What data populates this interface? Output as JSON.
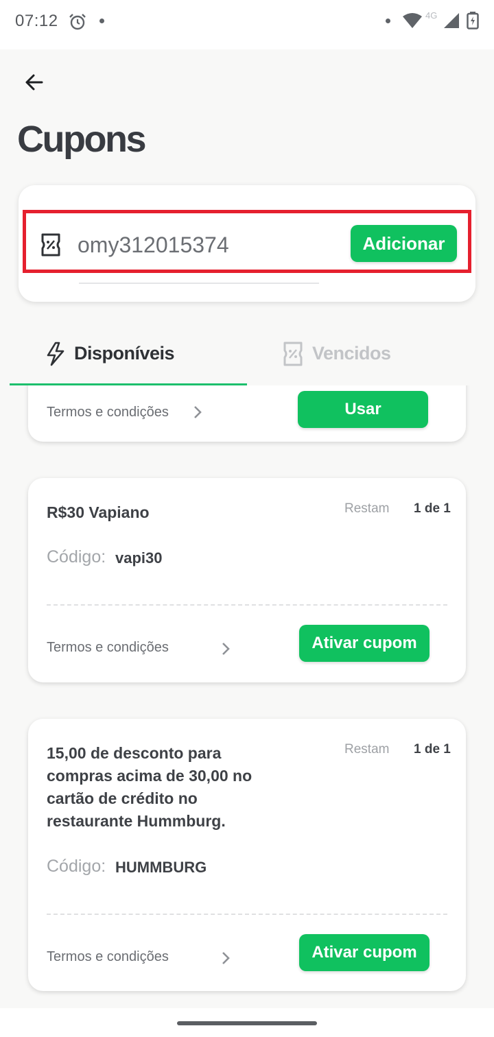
{
  "status_bar": {
    "time": "07:12",
    "network": "4G",
    "icons": [
      "alarm-icon",
      "wifi-icon",
      "signal-icon",
      "battery-icon"
    ]
  },
  "header": {
    "back_icon": "arrow-left-icon",
    "title": "Cupons"
  },
  "coupon_input": {
    "icon": "coupon-icon",
    "value": "omy312015374",
    "add_button": "Adicionar"
  },
  "tabs": [
    {
      "label": "Disponíveis",
      "icon": "lightning-icon",
      "active": true
    },
    {
      "label": "Vencidos",
      "icon": "coupon-icon",
      "active": false
    }
  ],
  "cards": [
    {
      "terms": "Termos e condições",
      "button": "Usar"
    },
    {
      "title": "R$30 Vapiano",
      "remain_label": "Restam",
      "remain_value": "1 de 1",
      "code_label": "Código:",
      "code": "vapi30",
      "terms": "Termos e condições",
      "button": "Ativar cupom"
    },
    {
      "title": "15,00 de desconto para compras acima de 30,00 no cartão de crédito no restaurante Hummburg.",
      "remain_label": "Restam",
      "remain_value": "1 de 1",
      "code_label": "Código:",
      "code": "HUMMBURG",
      "terms": "Termos e condições",
      "button": "Ativar cupom"
    }
  ],
  "colors": {
    "accent": "#10c15f",
    "tab_indicator": "#1cbf6c",
    "highlight": "#e5202e",
    "background": "#f8f8f7"
  }
}
